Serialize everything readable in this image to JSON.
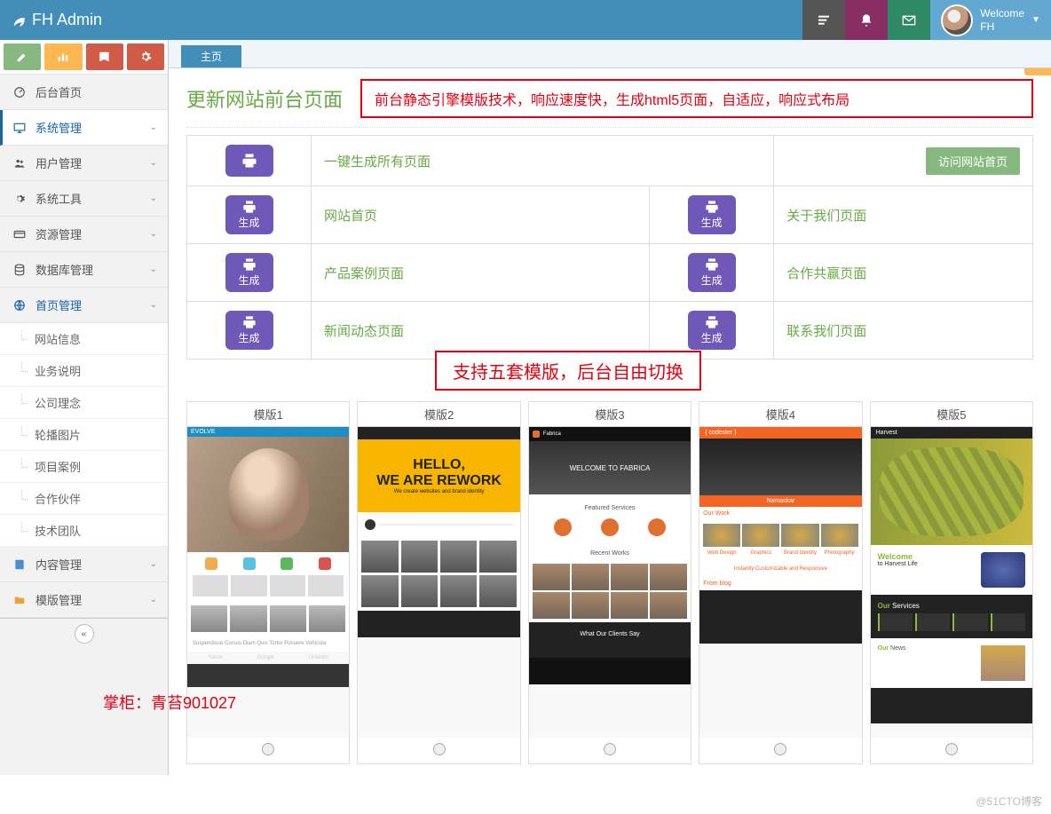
{
  "brand": "FH Admin",
  "navbar_user": {
    "welcome": "Welcome",
    "name": "FH"
  },
  "sidebar": {
    "items": [
      {
        "label": "后台首页",
        "icon": "dashboard"
      },
      {
        "label": "系统管理",
        "icon": "monitor",
        "active": true,
        "expand": true
      },
      {
        "label": "用户管理",
        "icon": "users",
        "expand": true
      },
      {
        "label": "系统工具",
        "icon": "gear",
        "expand": true
      },
      {
        "label": "资源管理",
        "icon": "card",
        "expand": true
      },
      {
        "label": "数据库管理",
        "icon": "db",
        "expand": true
      },
      {
        "label": "首页管理",
        "icon": "globe",
        "expand": true,
        "open": true
      }
    ],
    "sub_home": [
      "网站信息",
      "业务说明",
      "公司理念",
      "轮播图片",
      "项目案例",
      "合作伙伴",
      "技术团队"
    ],
    "tail": [
      {
        "label": "内容管理",
        "icon": "book"
      },
      {
        "label": "模版管理",
        "icon": "folder"
      }
    ]
  },
  "tab_label": "主页",
  "page_title": "更新网站前台页面",
  "red_note": "前台静态引擎模版技术，响应速度快，生成html5页面，自适应，响应式布局",
  "gen_btn_label": "生成",
  "visit_btn_label": "访问网站首页",
  "rows": [
    {
      "left": "一键生成所有页面"
    },
    {
      "left": "网站首页",
      "right": "关于我们页面"
    },
    {
      "left": "产品案例页面",
      "right": "合作共赢页面"
    },
    {
      "left": "新闻动态页面",
      "right": "联系我们页面"
    }
  ],
  "red_note2": "支持五套模版，后台自由切换",
  "templates": [
    "模版1",
    "模版2",
    "模版3",
    "模版4",
    "模版5"
  ],
  "tpl2": {
    "hello": "HELLO,",
    "rework": "WE ARE REWORK",
    "sub": "We create websites and brand identity"
  },
  "tpl3": {
    "welcome": "WELCOME TO FABRICA",
    "services": "Featured Services",
    "recent": "Recent Works",
    "clients": "What Our Clients Say"
  },
  "tpl4": {
    "brand": "{ codester }",
    "work": "Our Work",
    "blog": "From blog",
    "msg": "Instantly Customizable and Responsive"
  },
  "tpl5": {
    "welcome": "Welcome",
    "to": "to Harvest Life",
    "services": "Our Services",
    "news": "Our News"
  },
  "watermark": "掌柜：青苔901027",
  "wm2": "@51CTO博客"
}
